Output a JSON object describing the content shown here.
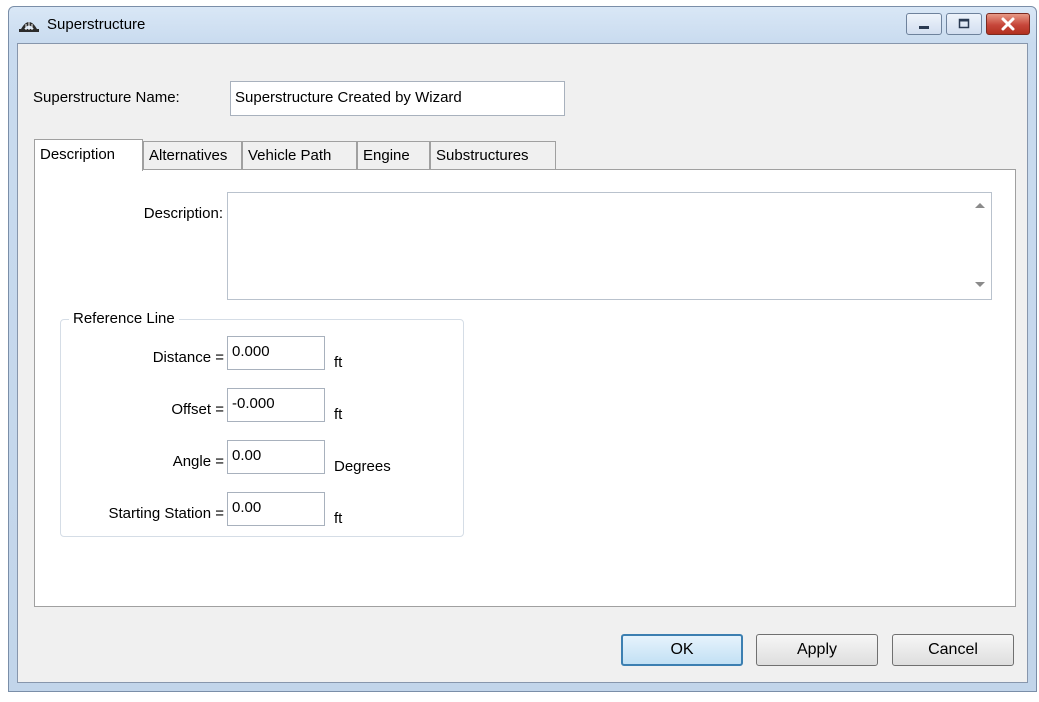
{
  "window": {
    "title": "Superstructure",
    "controls": {
      "minimize": "minimize",
      "maximize": "maximize",
      "close": "close"
    }
  },
  "form": {
    "name_label": "Superstructure Name:",
    "name_value": "Superstructure Created by Wizard"
  },
  "tabs": [
    {
      "label": "Description",
      "active": true
    },
    {
      "label": "Alternatives",
      "active": false
    },
    {
      "label": "Vehicle Path",
      "active": false
    },
    {
      "label": "Engine",
      "active": false
    },
    {
      "label": "Substructures",
      "active": false
    }
  ],
  "description": {
    "label": "Description:",
    "value": ""
  },
  "reference_line": {
    "title": "Reference Line",
    "distance": {
      "label": "Distance =",
      "value": "0.000",
      "unit": "ft"
    },
    "offset": {
      "label": "Offset =",
      "value": "-0.000",
      "unit": "ft"
    },
    "angle": {
      "label": "Angle =",
      "value": "0.00",
      "unit": "Degrees"
    },
    "starting_station": {
      "label": "Starting Station =",
      "value": "0.00",
      "unit": "ft"
    }
  },
  "buttons": {
    "ok": "OK",
    "apply": "Apply",
    "cancel": "Cancel"
  },
  "colors": {
    "default_button_border": "#3c7fb1",
    "close_button": "#c6463a"
  }
}
